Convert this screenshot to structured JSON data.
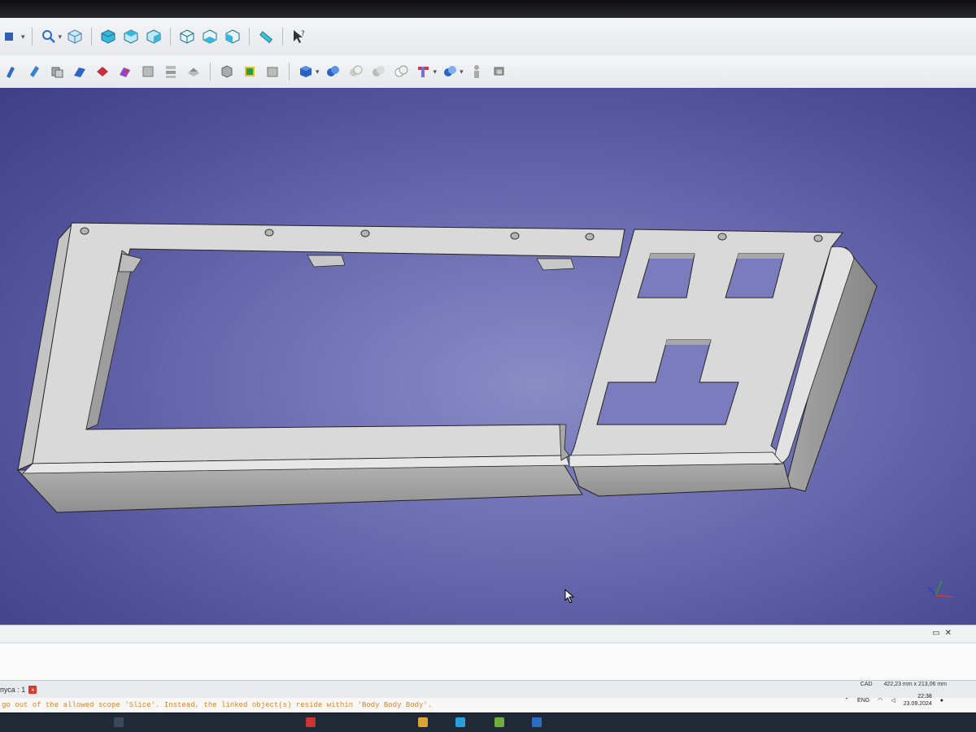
{
  "toolbar_top": {
    "icons": [
      "part-icon",
      "zoom-icon",
      "view-isometric-icon",
      "view-front-icon",
      "view-top-icon",
      "view-right-icon",
      "view-rear-icon",
      "view-bottom-icon",
      "view-left-icon",
      "measure-icon",
      "whats-this-icon"
    ]
  },
  "toolbar_part": {
    "icons": [
      "extrude-icon",
      "revolve-icon",
      "mirror-icon",
      "fillet-icon",
      "chamfer-icon",
      "make-face-icon",
      "ruled-surface-icon",
      "loft-icon",
      "sweep-icon",
      "section-icon",
      "cross-sections-icon",
      "offset-icon",
      "thickness-icon",
      "projection-icon",
      "boolean-icon",
      "cut-icon",
      "fuse-icon",
      "common-icon",
      "join-icon",
      "split-icon",
      "compound-icon",
      "check-geometry-icon"
    ]
  },
  "viewport": {
    "colors": {
      "bg_center": "#8a8cc6",
      "bg_edge": "#3e3f86",
      "model": "#d7d7d7",
      "model_shadow": "#9c9c9c"
    }
  },
  "document_tab": {
    "label": "пуса : 1"
  },
  "report_message": "go out of the allowed scope 'Slice'. Instead, the linked object(s) reside within 'Body Body Body'.",
  "status": {
    "nav_style": "CAD",
    "dimensions": "422,23 mm x 213,06 mm"
  },
  "tray": {
    "language": "ENG",
    "time": "22:38",
    "date": "23.09.2024"
  }
}
